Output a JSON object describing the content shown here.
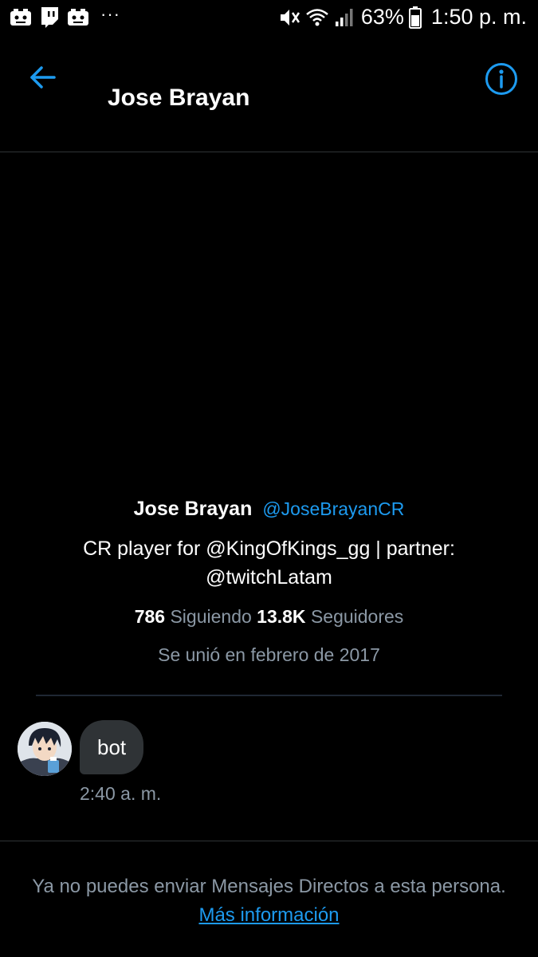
{
  "status_bar": {
    "left_icons": [
      "game-controller-icon",
      "twitch-icon",
      "game-controller-icon"
    ],
    "more_dots": "···",
    "right_icons": [
      "mute-vibrate-icon",
      "wifi-icon",
      "signal-icon",
      "battery-icon"
    ],
    "battery_percent": "63%",
    "time": "1:50 p. m."
  },
  "header": {
    "title": "Jose Brayan",
    "back_icon": "arrow-left-icon",
    "info_icon": "info-icon"
  },
  "profile": {
    "name": "Jose Brayan",
    "handle": "@JoseBrayanCR",
    "bio": "CR player for @KingOfKings_gg | partner: @twitchLatam",
    "following_count": "786",
    "following_label": "Siguiendo",
    "followers_count": "13.8K",
    "followers_label": "Seguidores",
    "joined": "Se unió en febrero de 2017"
  },
  "messages": [
    {
      "text": "bot",
      "time": "2:40 a. m."
    }
  ],
  "footer": {
    "note": "Ya no puedes enviar Mensajes Directos a esta persona.",
    "link": "Más información"
  },
  "colors": {
    "background": "#000000",
    "accent": "#1d9bf0",
    "bubble": "#2f3336",
    "muted_text": "#8b98a5"
  }
}
